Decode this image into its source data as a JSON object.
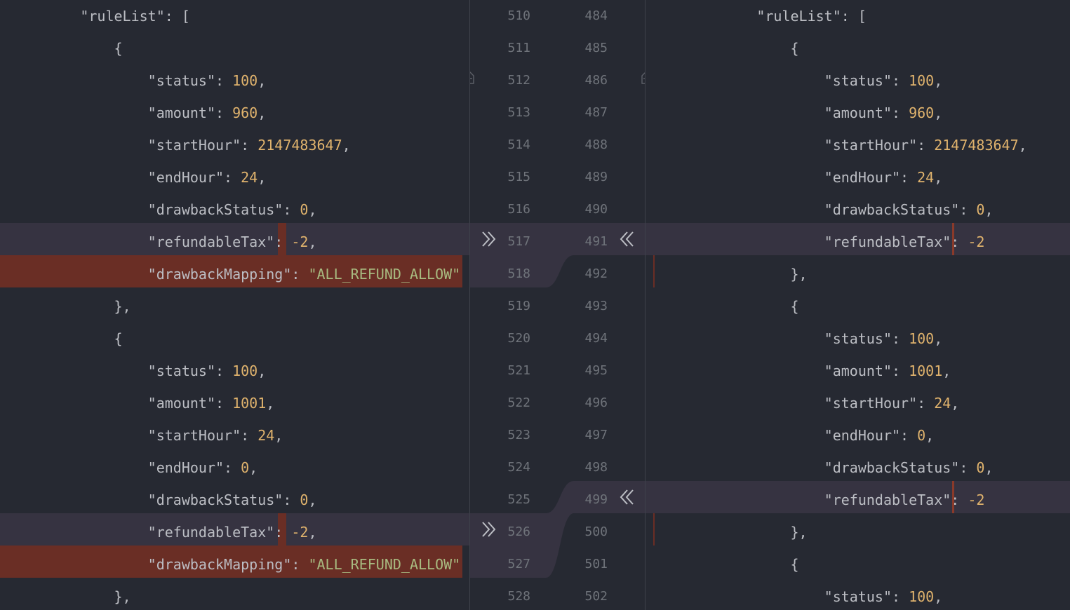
{
  "left_lines": [
    {
      "indent": "    ",
      "parts": [
        [
          "\"ruleList\"",
          "k"
        ],
        [
          ": [",
          "p"
        ]
      ]
    },
    {
      "indent": "      ",
      "parts": [
        [
          "{",
          "p"
        ]
      ]
    },
    {
      "indent": "        ",
      "parts": [
        [
          "\"status\"",
          "k"
        ],
        [
          ": ",
          "p"
        ],
        [
          "100",
          "n"
        ],
        [
          ",",
          "p"
        ]
      ]
    },
    {
      "indent": "        ",
      "parts": [
        [
          "\"amount\"",
          "k"
        ],
        [
          ": ",
          "p"
        ],
        [
          "960",
          "n"
        ],
        [
          ",",
          "p"
        ]
      ]
    },
    {
      "indent": "        ",
      "parts": [
        [
          "\"startHour\"",
          "k"
        ],
        [
          ": ",
          "p"
        ],
        [
          "2147483647",
          "n"
        ],
        [
          ",",
          "p"
        ]
      ]
    },
    {
      "indent": "        ",
      "parts": [
        [
          "\"endHour\"",
          "k"
        ],
        [
          ": ",
          "p"
        ],
        [
          "24",
          "n"
        ],
        [
          ",",
          "p"
        ]
      ]
    },
    {
      "indent": "        ",
      "parts": [
        [
          "\"drawbackStatus\"",
          "k"
        ],
        [
          ": ",
          "p"
        ],
        [
          "0",
          "n"
        ],
        [
          ",",
          "p"
        ]
      ]
    },
    {
      "indent": "        ",
      "parts": [
        [
          "\"refundableTax\"",
          "k"
        ],
        [
          ": ",
          "p"
        ],
        [
          "-2",
          "n"
        ],
        [
          ",",
          "p"
        ]
      ]
    },
    {
      "indent": "        ",
      "parts": [
        [
          "\"drawbackMapping\"",
          "k"
        ],
        [
          ": ",
          "p"
        ],
        [
          "\"ALL_REFUND_ALLOW\"",
          "s"
        ]
      ]
    },
    {
      "indent": "      ",
      "parts": [
        [
          "},",
          "p"
        ]
      ]
    },
    {
      "indent": "      ",
      "parts": [
        [
          "{",
          "p"
        ]
      ]
    },
    {
      "indent": "        ",
      "parts": [
        [
          "\"status\"",
          "k"
        ],
        [
          ": ",
          "p"
        ],
        [
          "100",
          "n"
        ],
        [
          ",",
          "p"
        ]
      ]
    },
    {
      "indent": "        ",
      "parts": [
        [
          "\"amount\"",
          "k"
        ],
        [
          ": ",
          "p"
        ],
        [
          "1001",
          "n"
        ],
        [
          ",",
          "p"
        ]
      ]
    },
    {
      "indent": "        ",
      "parts": [
        [
          "\"startHour\"",
          "k"
        ],
        [
          ": ",
          "p"
        ],
        [
          "24",
          "n"
        ],
        [
          ",",
          "p"
        ]
      ]
    },
    {
      "indent": "        ",
      "parts": [
        [
          "\"endHour\"",
          "k"
        ],
        [
          ": ",
          "p"
        ],
        [
          "0",
          "n"
        ],
        [
          ",",
          "p"
        ]
      ]
    },
    {
      "indent": "        ",
      "parts": [
        [
          "\"drawbackStatus\"",
          "k"
        ],
        [
          ": ",
          "p"
        ],
        [
          "0",
          "n"
        ],
        [
          ",",
          "p"
        ]
      ]
    },
    {
      "indent": "        ",
      "parts": [
        [
          "\"refundableTax\"",
          "k"
        ],
        [
          ": ",
          "p"
        ],
        [
          "-2",
          "n"
        ],
        [
          ",",
          "p"
        ]
      ]
    },
    {
      "indent": "        ",
      "parts": [
        [
          "\"drawbackMapping\"",
          "k"
        ],
        [
          ": ",
          "p"
        ],
        [
          "\"ALL_REFUND_ALLOW\"",
          "s"
        ]
      ]
    },
    {
      "indent": "      ",
      "parts": [
        [
          "},",
          "p"
        ]
      ]
    }
  ],
  "right_lines": [
    {
      "indent": "    ",
      "parts": [
        [
          "\"ruleList\"",
          "k"
        ],
        [
          ": [",
          "p"
        ]
      ]
    },
    {
      "indent": "      ",
      "parts": [
        [
          "{",
          "p"
        ]
      ]
    },
    {
      "indent": "        ",
      "parts": [
        [
          "\"status\"",
          "k"
        ],
        [
          ": ",
          "p"
        ],
        [
          "100",
          "n"
        ],
        [
          ",",
          "p"
        ]
      ]
    },
    {
      "indent": "        ",
      "parts": [
        [
          "\"amount\"",
          "k"
        ],
        [
          ": ",
          "p"
        ],
        [
          "960",
          "n"
        ],
        [
          ",",
          "p"
        ]
      ]
    },
    {
      "indent": "        ",
      "parts": [
        [
          "\"startHour\"",
          "k"
        ],
        [
          ": ",
          "p"
        ],
        [
          "2147483647",
          "n"
        ],
        [
          ",",
          "p"
        ]
      ]
    },
    {
      "indent": "        ",
      "parts": [
        [
          "\"endHour\"",
          "k"
        ],
        [
          ": ",
          "p"
        ],
        [
          "24",
          "n"
        ],
        [
          ",",
          "p"
        ]
      ]
    },
    {
      "indent": "        ",
      "parts": [
        [
          "\"drawbackStatus\"",
          "k"
        ],
        [
          ": ",
          "p"
        ],
        [
          "0",
          "n"
        ],
        [
          ",",
          "p"
        ]
      ]
    },
    {
      "indent": "        ",
      "parts": [
        [
          "\"refundableTax\"",
          "k"
        ],
        [
          ": ",
          "p"
        ],
        [
          "-2",
          "n"
        ]
      ]
    },
    {
      "indent": "      ",
      "parts": [
        [
          "},",
          "p"
        ]
      ]
    },
    {
      "indent": "      ",
      "parts": [
        [
          "{",
          "p"
        ]
      ]
    },
    {
      "indent": "        ",
      "parts": [
        [
          "\"status\"",
          "k"
        ],
        [
          ": ",
          "p"
        ],
        [
          "100",
          "n"
        ],
        [
          ",",
          "p"
        ]
      ]
    },
    {
      "indent": "        ",
      "parts": [
        [
          "\"amount\"",
          "k"
        ],
        [
          ": ",
          "p"
        ],
        [
          "1001",
          "n"
        ],
        [
          ",",
          "p"
        ]
      ]
    },
    {
      "indent": "        ",
      "parts": [
        [
          "\"startHour\"",
          "k"
        ],
        [
          ": ",
          "p"
        ],
        [
          "24",
          "n"
        ],
        [
          ",",
          "p"
        ]
      ]
    },
    {
      "indent": "        ",
      "parts": [
        [
          "\"endHour\"",
          "k"
        ],
        [
          ": ",
          "p"
        ],
        [
          "0",
          "n"
        ],
        [
          ",",
          "p"
        ]
      ]
    },
    {
      "indent": "        ",
      "parts": [
        [
          "\"drawbackStatus\"",
          "k"
        ],
        [
          ": ",
          "p"
        ],
        [
          "0",
          "n"
        ],
        [
          ",",
          "p"
        ]
      ]
    },
    {
      "indent": "        ",
      "parts": [
        [
          "\"refundableTax\"",
          "k"
        ],
        [
          ": ",
          "p"
        ],
        [
          "-2",
          "n"
        ]
      ]
    },
    {
      "indent": "      ",
      "parts": [
        [
          "},",
          "p"
        ]
      ]
    },
    {
      "indent": "      ",
      "parts": [
        [
          "{",
          "p"
        ]
      ]
    },
    {
      "indent": "        ",
      "parts": [
        [
          "\"status\"",
          "k"
        ],
        [
          ": ",
          "p"
        ],
        [
          "100",
          "n"
        ],
        [
          ",",
          "p"
        ]
      ]
    }
  ],
  "left_numbers": [
    "510",
    "511",
    "512",
    "513",
    "514",
    "515",
    "516",
    "517",
    "518",
    "519",
    "520",
    "521",
    "522",
    "523",
    "524",
    "525",
    "526",
    "527",
    "528"
  ],
  "right_numbers": [
    "484",
    "485",
    "486",
    "487",
    "488",
    "489",
    "490",
    "491",
    "492",
    "493",
    "494",
    "495",
    "496",
    "497",
    "498",
    "499",
    "500",
    "501",
    "502"
  ],
  "icons": {
    "apply_right": "double-chevron-right-icon",
    "apply_left": "double-chevron-left-icon",
    "fold": "fold-marker-icon"
  },
  "colors": {
    "background": "#262932",
    "modified": "#363341",
    "deleted": "#6a2e25",
    "key": "#bcbec4",
    "number": "#e0b36d",
    "string": "#a8ba80",
    "line_number": "#6f737a"
  }
}
